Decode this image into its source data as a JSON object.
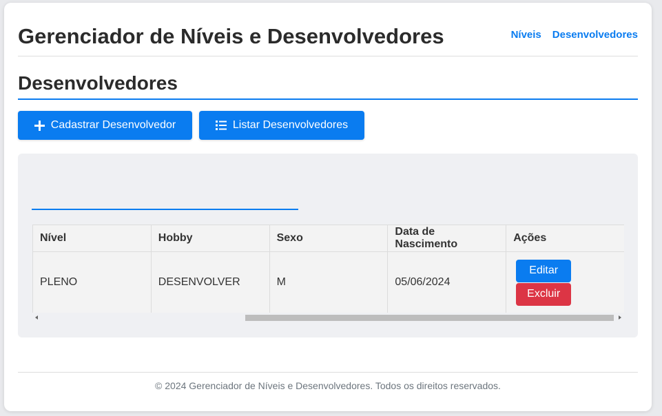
{
  "header": {
    "title": "Gerenciador de Níveis e Desenvolvedores",
    "nav": [
      {
        "label": "Níveis"
      },
      {
        "label": "Desenvolvedores"
      }
    ]
  },
  "section": {
    "title": "Desenvolvedores"
  },
  "toolbar": {
    "add_label": "Cadastrar Desenvolvedor",
    "add_icon": "plus-icon",
    "list_label": "Listar Desenvolvedores",
    "list_icon": "list-icon"
  },
  "table": {
    "columns": [
      "Nível",
      "Hobby",
      "Sexo",
      "Data de Nascimento",
      "Ações"
    ],
    "rows": [
      {
        "nivel": "PLENO",
        "hobby": "DESENVOLVER",
        "sexo": "M",
        "data_nascimento": "05/06/2024",
        "edit_label": "Editar",
        "delete_label": "Excluir"
      }
    ]
  },
  "footer": {
    "text": "© 2024 Gerenciador de Níveis e Desenvolvedores. Todos os direitos reservados."
  },
  "colors": {
    "accent": "#0a7cf0",
    "danger": "#dc3545",
    "panel": "#eff0f3"
  }
}
